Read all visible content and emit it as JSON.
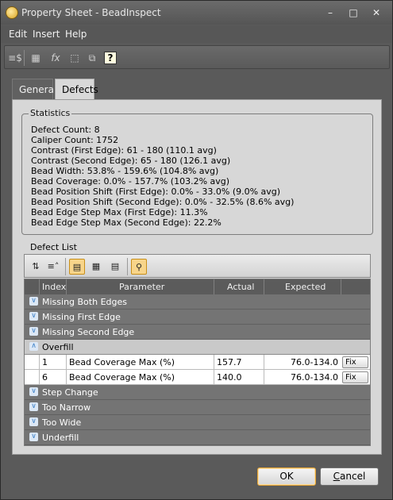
{
  "window": {
    "title": "Property Sheet - BeadInspect"
  },
  "menu": [
    "Edit",
    "Insert",
    "Help"
  ],
  "toolbar": {
    "icons": [
      "grid-dollar-icon",
      "table-icon",
      "function-icon",
      "select-icon",
      "crop-icon",
      "help-icon"
    ],
    "help_glyph": "?"
  },
  "tabs": [
    {
      "label": "General",
      "active": false
    },
    {
      "label": "Defects",
      "active": true
    }
  ],
  "statistics": {
    "legend": "Statistics",
    "lines": [
      "Defect Count: 8",
      "Caliper Count: 1752",
      "Contrast (First Edge): 61 - 180 (110.1 avg)",
      "Contrast (Second Edge): 65 - 180 (126.1 avg)",
      "Bead Width: 53.8% - 159.6% (104.8% avg)",
      "Bead Coverage: 0.0% - 157.7% (103.2% avg)",
      "Bead Position Shift (First Edge): 0.0% - 33.0% (9.0% avg)",
      "Bead Position Shift (Second Edge): 0.0% - 32.5% (8.6% avg)",
      "Bead Edge Step Max (First Edge): 11.3%",
      "Bead Edge Step Max (Second Edge): 22.2%"
    ]
  },
  "defect_list": {
    "label": "Defect List",
    "columns": [
      "Index",
      "Parameter",
      "Actual",
      "Expected"
    ],
    "groups": [
      {
        "name": "Missing Both Edges",
        "expanded": false
      },
      {
        "name": "Missing First Edge",
        "expanded": false
      },
      {
        "name": "Missing Second Edge",
        "expanded": false
      },
      {
        "name": "Overfill",
        "expanded": true
      },
      {
        "name": "Step Change",
        "expanded": false
      },
      {
        "name": "Too Narrow",
        "expanded": false
      },
      {
        "name": "Too Wide",
        "expanded": false
      },
      {
        "name": "Underfill",
        "expanded": false
      }
    ],
    "rows": [
      {
        "index": "1",
        "parameter": "Bead Coverage Max (%)",
        "actual": "157.7",
        "expected": "76.0-134.0",
        "action": "Fix"
      },
      {
        "index": "6",
        "parameter": "Bead Coverage Max (%)",
        "actual": "140.0",
        "expected": "76.0-134.0",
        "action": "Fix"
      }
    ]
  },
  "buttons": {
    "ok": "OK",
    "cancel_underlined": "C",
    "cancel_rest": "ancel"
  },
  "colors": {
    "accent_highlight": "#f8d58a",
    "default_button_border": "#e3a437",
    "chevron_blue": "#3b7fc6"
  }
}
